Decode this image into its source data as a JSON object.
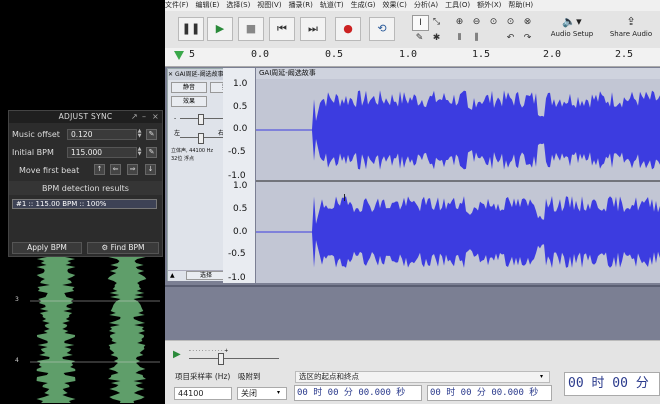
{
  "sync_panel": {
    "title": "ADJUST SYNC",
    "window_controls": [
      "↗",
      "–",
      "×"
    ],
    "music_offset_label": "Music offset",
    "music_offset_value": "0.120",
    "initial_bpm_label": "Initial BPM",
    "initial_bpm_value": "115.000",
    "move_first_beat_label": "Move first beat",
    "bpm_results_heading": "BPM detection results",
    "bpm_result": "#1 :: 115.00 BPM :: 100%",
    "apply_bpm": "Apply BPM",
    "find_bpm": "Find BPM"
  },
  "beat_numbers": [
    "3",
    "4"
  ],
  "menu": [
    "文件(F)",
    "编辑(E)",
    "选择(S)",
    "视图(V)",
    "播录(R)",
    "轨道(T)",
    "生成(G)",
    "效果(C)",
    "分析(A)",
    "工具(O)",
    "额外(X)",
    "帮助(H)"
  ],
  "toolbar": {
    "audio_setup": "Audio Setup",
    "share_audio": "Share Audio"
  },
  "ruler": {
    "start": "5",
    "ticks": [
      "0.0",
      "0.5",
      "1.0",
      "1.5",
      "2.0",
      "2.5"
    ]
  },
  "track": {
    "name": "GAI周延-阚选故事",
    "clip_name": "GAI周延-阚选故事",
    "mute": "静音",
    "solo": "独奏",
    "left": "左",
    "right": "右",
    "format": "立体声, 44100 Hz",
    "format2": "32位 浮点",
    "select": "选择",
    "y_labels_top": [
      "1.0",
      "0.5",
      "0.0",
      "-0.5",
      "-1.0"
    ],
    "y_labels_bottom": [
      "1.0",
      "0.5",
      "0.0",
      "-0.5",
      "-1.0"
    ]
  },
  "status": {
    "project_rate_label": "项目采样率 (Hz)",
    "project_rate_value": "44100",
    "snap_label": "吸附到",
    "snap_value": "关闭",
    "selection_label": "选区的起点和终点",
    "time1": "00 时 00 分 00.000 秒",
    "time2": "00 时 00 分 00.000 秒",
    "big_time": "00 时 00 分"
  }
}
